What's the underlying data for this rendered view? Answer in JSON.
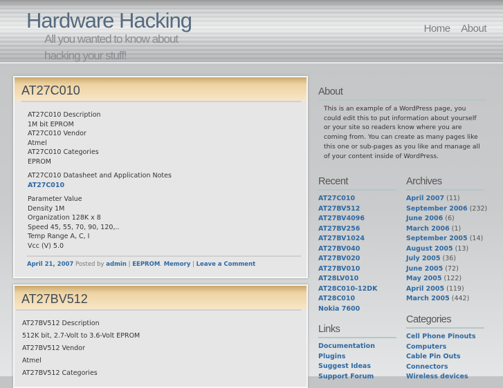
{
  "site": {
    "title": "Hardware Hacking",
    "tagline": "All you wanted to know about hacking your stuff!"
  },
  "nav": [
    {
      "label": "Home"
    },
    {
      "label": "About"
    }
  ],
  "posts": [
    {
      "title": "AT27C010",
      "paragraphs": [
        [
          "AT27C010 Description",
          "1M bit EPROM",
          "AT27C010 Vendor",
          "Atmel",
          "AT27C010 Categories",
          "EPROM"
        ]
      ],
      "datasheet_label": "AT27C010 Datasheet and Application Notes",
      "datasheet_link": "AT27C010",
      "params": [
        "Parameter Value",
        "Density 1M",
        "Organization 128K x 8",
        "Speed 45, 55, 70, 90, 120,..",
        "Temp Range A, C, I",
        "Vcc (V) 5.0"
      ],
      "meta": {
        "date": "April 21, 2007",
        "posted_by": "Posted by",
        "author": "admin",
        "sep": "|",
        "cat1": "EEPROM",
        "cat2": "Memory",
        "comment": "Leave a Comment"
      }
    },
    {
      "title": "AT27BV512",
      "lines": [
        "AT27BV512 Description",
        "512K bit, 2.7-Volt to 3.6-Volt EPROM",
        "AT27BV512 Vendor",
        "Atmel",
        "AT27BV512 Categories"
      ]
    }
  ],
  "sidebar": {
    "about": {
      "title": "About",
      "text": "This is an example of a WordPress page, you could edit this to put information about yourself or your site so readers know where you are coming from. You can create as many pages like this one or sub-pages as you like and manage all of your content inside of WordPress."
    },
    "recent": {
      "title": "Recent",
      "items": [
        "AT27C010",
        "AT27BV512",
        "AT27BV4096",
        "AT27BV256",
        "AT27BV1024",
        "AT27BV040",
        "AT27BV020",
        "AT27BV010",
        "AT28LV010",
        "AT28C010-12DK",
        "AT28C010",
        "Nokia 7600"
      ]
    },
    "links": {
      "title": "Links",
      "items": [
        "Documentation",
        "Plugins",
        "Suggest Ideas",
        "Support Forum"
      ]
    },
    "archives": {
      "title": "Archives",
      "items": [
        {
          "label": "April 2007",
          "count": "(11)"
        },
        {
          "label": "September 2006",
          "count": "(232)"
        },
        {
          "label": "June 2006",
          "count": "(6)"
        },
        {
          "label": "March 2006",
          "count": "(1)"
        },
        {
          "label": "September 2005",
          "count": "(14)"
        },
        {
          "label": "August 2005",
          "count": "(13)"
        },
        {
          "label": "July 2005",
          "count": "(36)"
        },
        {
          "label": "June 2005",
          "count": "(72)"
        },
        {
          "label": "May 2005",
          "count": "(122)"
        },
        {
          "label": "April 2005",
          "count": "(119)"
        },
        {
          "label": "March 2005",
          "count": "(442)"
        }
      ]
    },
    "categories": {
      "title": "Categories",
      "items": [
        "Cell Phone Pinouts",
        "Computers",
        "Cable Pin Outs",
        "Connectors",
        "Wireless devices"
      ]
    }
  },
  "colors": {
    "link": "#2f6aa3",
    "title": "#556b80"
  }
}
